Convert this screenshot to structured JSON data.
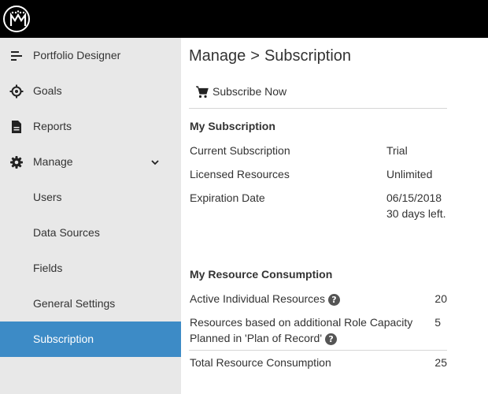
{
  "sidebar": {
    "items": [
      {
        "label": "Portfolio Designer",
        "icon": "portfolio-designer-icon"
      },
      {
        "label": "Goals",
        "icon": "target-icon"
      },
      {
        "label": "Reports",
        "icon": "document-icon"
      },
      {
        "label": "Manage",
        "icon": "gear-icon"
      },
      {
        "label": "Users"
      },
      {
        "label": "Data Sources"
      },
      {
        "label": "Fields"
      },
      {
        "label": "General Settings"
      },
      {
        "label": "Subscription",
        "active": true
      }
    ]
  },
  "main": {
    "breadcrumb": {
      "parent": "Manage",
      "separator": ">",
      "current": "Subscription"
    },
    "subscribe_label": "Subscribe Now",
    "my_subscription": {
      "title": "My Subscription",
      "rows": [
        {
          "label": "Current Subscription",
          "value": "Trial"
        },
        {
          "label": "Licensed Resources",
          "value": "Unlimited"
        },
        {
          "label": "Expiration Date",
          "value": "06/15/2018",
          "note": "30 days left."
        }
      ]
    },
    "resource_consumption": {
      "title": "My Resource Consumption",
      "rows": [
        {
          "label": "Active Individual Resources",
          "value": "20"
        },
        {
          "label_line1": "Resources based on additional Role Capacity",
          "label_line2": "Planned in 'Plan of Record'",
          "value": "5"
        },
        {
          "label": "Total Resource Consumption",
          "value": "25"
        }
      ]
    },
    "help_glyph": "?"
  },
  "colors": {
    "topbar": "#000000",
    "sidebar_bg": "#e8e8e8",
    "active_item": "#3d8bc6",
    "text": "#333333"
  }
}
